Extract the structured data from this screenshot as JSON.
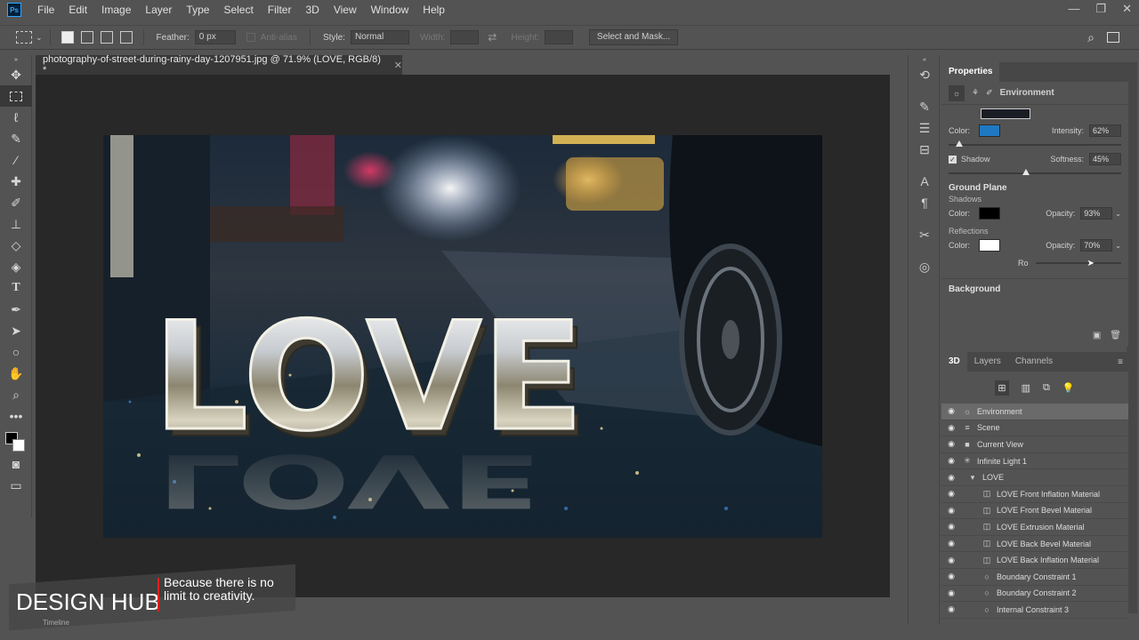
{
  "menubar": {
    "logo": "Ps",
    "items": [
      "File",
      "Edit",
      "Image",
      "Layer",
      "Type",
      "Select",
      "Filter",
      "3D",
      "View",
      "Window",
      "Help"
    ],
    "controls": [
      "—",
      "❐",
      "✕"
    ]
  },
  "options": {
    "feather_label": "Feather:",
    "feather_value": "0 px",
    "antialias_label": "Anti-alias",
    "style_label": "Style:",
    "style_value": "Normal",
    "width_label": "Width:",
    "height_label": "Height:",
    "select_mask": "Select and Mask..."
  },
  "document": {
    "tab_title": "photography-of-street-during-rainy-day-1207951.jpg @ 71.9% (LOVE, RGB/8) *",
    "close": "✕"
  },
  "image": {
    "text": "LOVE"
  },
  "properties": {
    "tab": "Properties",
    "mode": "Environment",
    "color_label": "Color:",
    "env_color": "#1f78c2",
    "intensity_label": "Intensity:",
    "intensity_value": "62%",
    "intensity_level": 0.62,
    "shadow_label": "Shadow",
    "softness_label": "Softness:",
    "softness_value": "45%",
    "softness_level": 0.45,
    "ground_plane": "Ground Plane",
    "shadows_label": "Shadows",
    "shadows_color": "#000000",
    "opacity_label": "Opacity:",
    "shadows_opacity": "93%",
    "reflections_label": "Reflections",
    "reflections_color": "#ffffff",
    "reflections_opacity": "70%",
    "roughness_label": "Ro",
    "background": "Background"
  },
  "layers_panel": {
    "tabs": [
      "3D",
      "Layers",
      "Channels"
    ],
    "items": [
      {
        "label": "Environment",
        "icon": "☼"
      },
      {
        "label": "Scene",
        "icon": "≡"
      },
      {
        "label": "Current View",
        "icon": "■"
      },
      {
        "label": "Infinite Light 1",
        "icon": "✳"
      },
      {
        "label": "LOVE",
        "icon": "▾"
      },
      {
        "label": "LOVE Front Inflation Material",
        "icon": "◫"
      },
      {
        "label": "LOVE Front Bevel Material",
        "icon": "◫"
      },
      {
        "label": "LOVE Extrusion Material",
        "icon": "◫"
      },
      {
        "label": "LOVE Back Bevel Material",
        "icon": "◫"
      },
      {
        "label": "LOVE Back Inflation Material",
        "icon": "◫"
      },
      {
        "label": "Boundary Constraint 1",
        "icon": "○"
      },
      {
        "label": "Boundary Constraint 2",
        "icon": "○"
      },
      {
        "label": "Internal Constraint 3",
        "icon": "○"
      }
    ]
  },
  "watermark": {
    "brand": "DESIGN HUB",
    "tagline_1": "Because there is no",
    "tagline_2": "limit to creativity."
  },
  "timeline": "Timeline"
}
